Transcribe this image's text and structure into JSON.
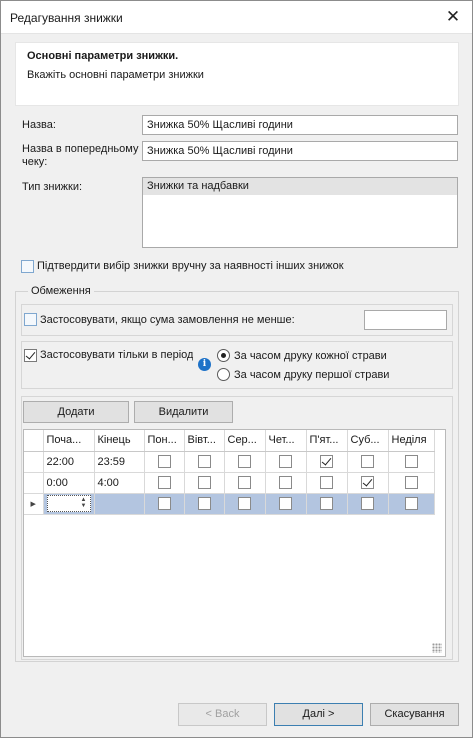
{
  "window": {
    "title": "Редагування знижки",
    "close_symbol": "✕"
  },
  "header": {
    "title": "Основні параметри знижки.",
    "subtitle": "Вкажіть основні параметри знижки"
  },
  "form": {
    "name_label": "Назва:",
    "name_value": "Знижка 50% Щасливі години",
    "receipt_label_1": "Назва в попередньому",
    "receipt_label_2": "чеку:",
    "receipt_value": "Знижка 50% Щасливі години",
    "type_label": "Тип знижки:",
    "type_options": [
      "Знижки та надбавки"
    ],
    "confirm_manual_label": "Підтвердити вибір знижки вручну за наявності інших знижок",
    "confirm_manual_checked": false
  },
  "restrictions": {
    "legend": "Обмеження",
    "min_sum_label": "Застосовувати, якщо сума замовлення не менше:",
    "min_sum_checked": false,
    "min_sum_value": "",
    "period_label": "Застосовувати тільки в період",
    "period_checked": true,
    "info_icon_glyph": "i",
    "radio_each_dish": "За часом друку кожної страви",
    "radio_first_dish": "За часом друку першої страви",
    "radio_selected": "each_dish",
    "add_button": "Додати",
    "delete_button": "Видалити"
  },
  "grid": {
    "columns": [
      "Поча...",
      "Кінець",
      "Пон...",
      "Вівт...",
      "Сер...",
      "Чет...",
      "П'ят...",
      "Суб...",
      "Неділя"
    ],
    "rows": [
      {
        "start": "22:00",
        "end": "23:59",
        "days": [
          false,
          false,
          false,
          false,
          true,
          false,
          false
        ]
      },
      {
        "start": "0:00",
        "end": "4:00",
        "days": [
          false,
          false,
          false,
          false,
          false,
          true,
          false
        ]
      }
    ],
    "new_row": {
      "start": "",
      "end": "",
      "days": [
        false,
        false,
        false,
        false,
        false,
        false,
        false
      ]
    },
    "spin_up": "▲",
    "spin_down": "▼",
    "current_row_marker": "▶"
  },
  "footer": {
    "back_button": "< Back",
    "next_button": "Далі >",
    "cancel_button": "Скасування"
  }
}
